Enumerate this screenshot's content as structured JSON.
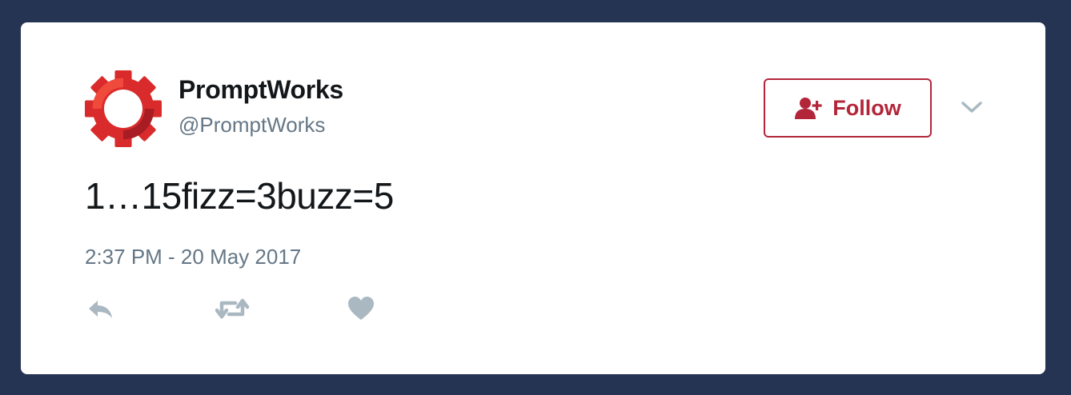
{
  "tweet": {
    "display_name": "PromptWorks",
    "handle": "@PromptWorks",
    "text": "1…15fizz=3buzz=5",
    "timestamp": "2:37 PM - 20 May 2017",
    "follow_label": "Follow"
  },
  "icons": {
    "avatar": "promptworks-gear-logo",
    "follow": "add-user-icon",
    "menu": "chevron-down-icon",
    "reply": "reply-icon",
    "retweet": "retweet-icon",
    "like": "heart-icon"
  },
  "colors": {
    "background": "#243452",
    "card": "#ffffff",
    "accent": "#b3263a",
    "text": "#14171a",
    "muted": "#657786",
    "action_icon": "#aab8c2"
  }
}
